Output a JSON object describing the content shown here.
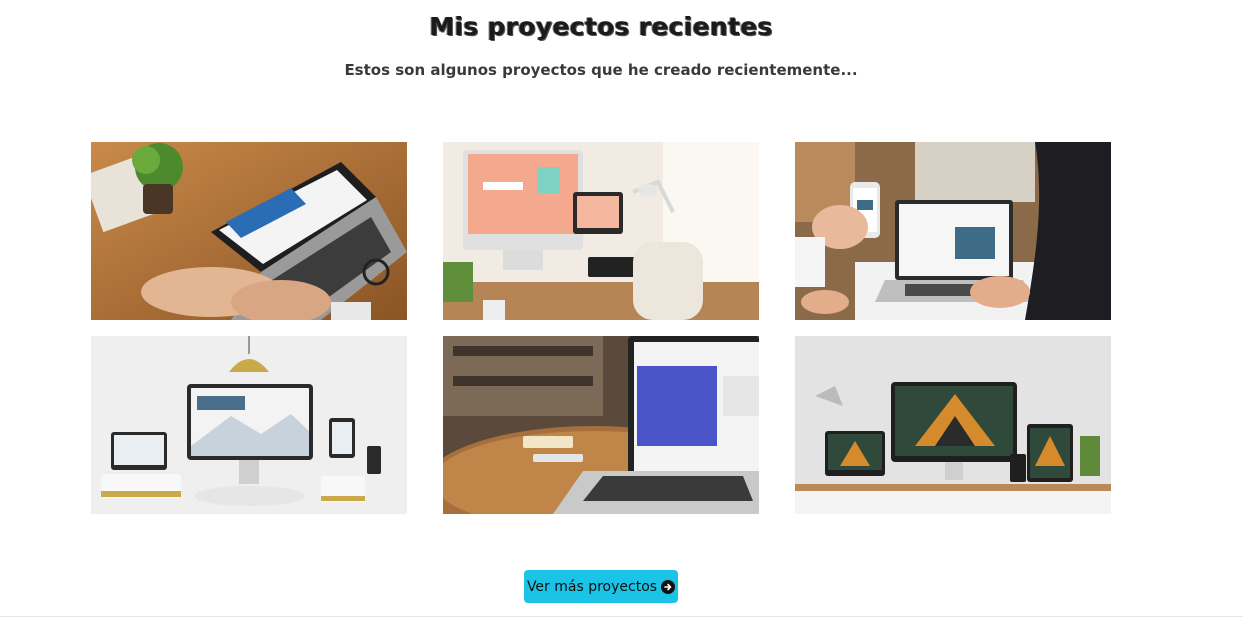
{
  "section": {
    "title": "Mis proyectos recientes",
    "subtitle": "Estos son algunos proyectos que he creado recientemente..."
  },
  "projects": [
    {
      "image": "laptop-web-design-image"
    },
    {
      "image": "desktop-monitor-workspace-image"
    },
    {
      "image": "phone-and-laptop-image"
    },
    {
      "image": "responsive-devices-image"
    },
    {
      "image": "laptop-on-round-table-image"
    },
    {
      "image": "architecture-devices-image"
    }
  ],
  "cta": {
    "label": "Ver más proyectos",
    "icon": "arrow-right-circle-icon",
    "color": "#1bc3e6"
  }
}
